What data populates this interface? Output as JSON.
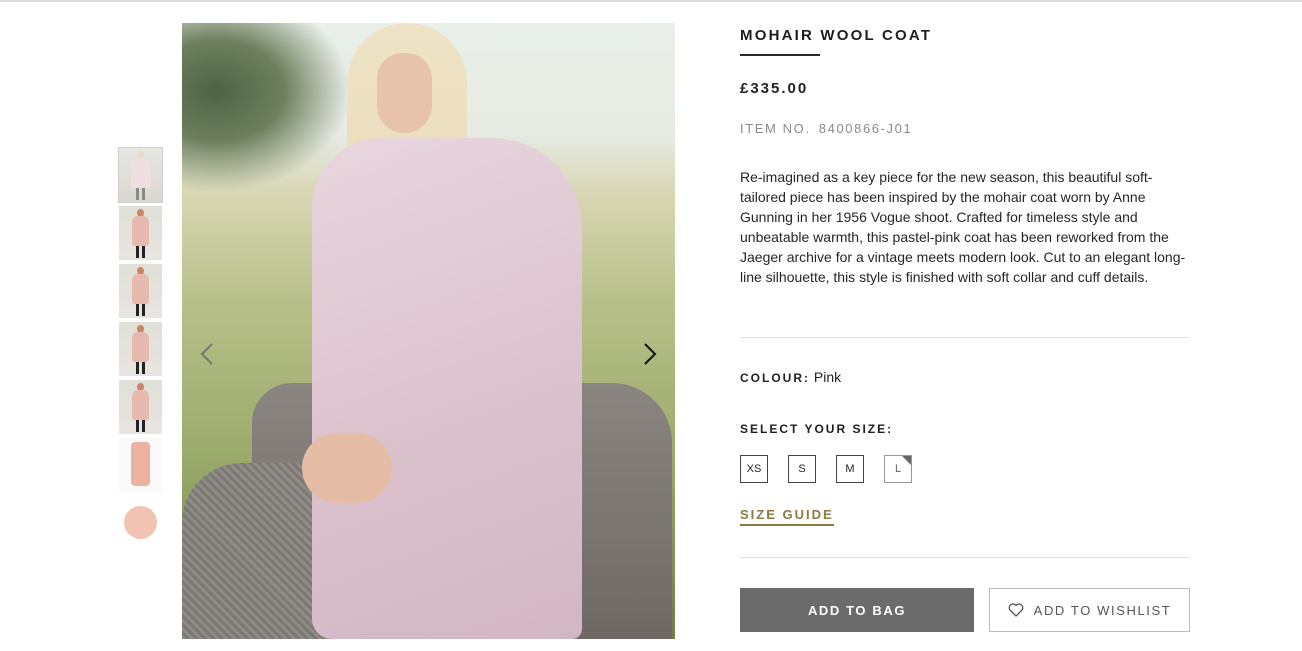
{
  "product": {
    "title": "MOHAIR WOOL COAT",
    "price": "£335.00",
    "item_no_label": "ITEM NO.",
    "item_no": "8400866-J01",
    "description": "Re-imagined as a key piece for the new season, this beautiful soft-tailored piece has been inspired by the mohair coat worn by Anne Gunning in her 1956 Vogue shoot. Crafted for timeless style and unbeatable warmth, this pastel-pink coat has been reworked from the Jaeger archive for a vintage meets modern look. Cut to an elegant long-line silhouette, this style is finished with soft collar and cuff details.",
    "colour_label": "COLOUR:",
    "colour": "Pink",
    "size_label": "SELECT YOUR SIZE:",
    "sizes": [
      "XS",
      "S",
      "M",
      "L"
    ],
    "size_guide": "SIZE GUIDE",
    "add_to_bag": "ADD TO BAG",
    "add_to_wishlist": "ADD TO WISHLIST"
  },
  "gallery": {
    "thumbnail_count": 7,
    "prev_icon": "chevron-left-icon",
    "next_icon": "chevron-right-icon"
  },
  "colors": {
    "accent_link": "#8b7a42",
    "bag_button": "#6b6b6b"
  }
}
